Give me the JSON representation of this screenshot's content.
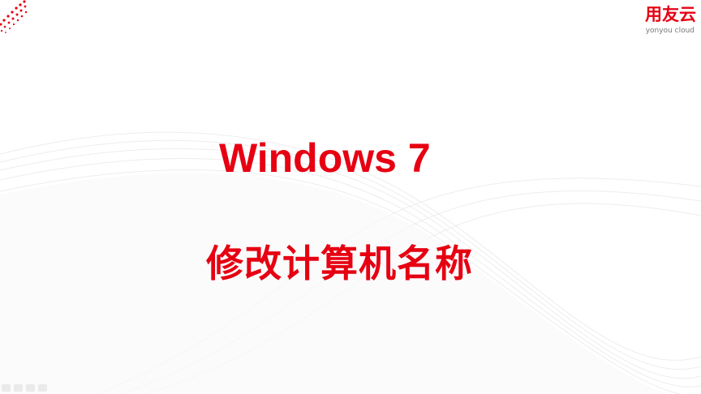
{
  "slide": {
    "title": "Windows 7",
    "subtitle": "修改计算机名称"
  },
  "logo": {
    "mark": "用友云",
    "sub": "yonyou cloud"
  },
  "colors": {
    "accent": "#e60012",
    "background": "#ffffff",
    "wave": "#ececec",
    "logo_sub": "#777777"
  },
  "icons": {
    "corner_decoration": "dot-pattern-icon",
    "toolbar": [
      "prev-slide-icon",
      "pen-icon",
      "slides-icon",
      "next-slide-icon"
    ]
  }
}
